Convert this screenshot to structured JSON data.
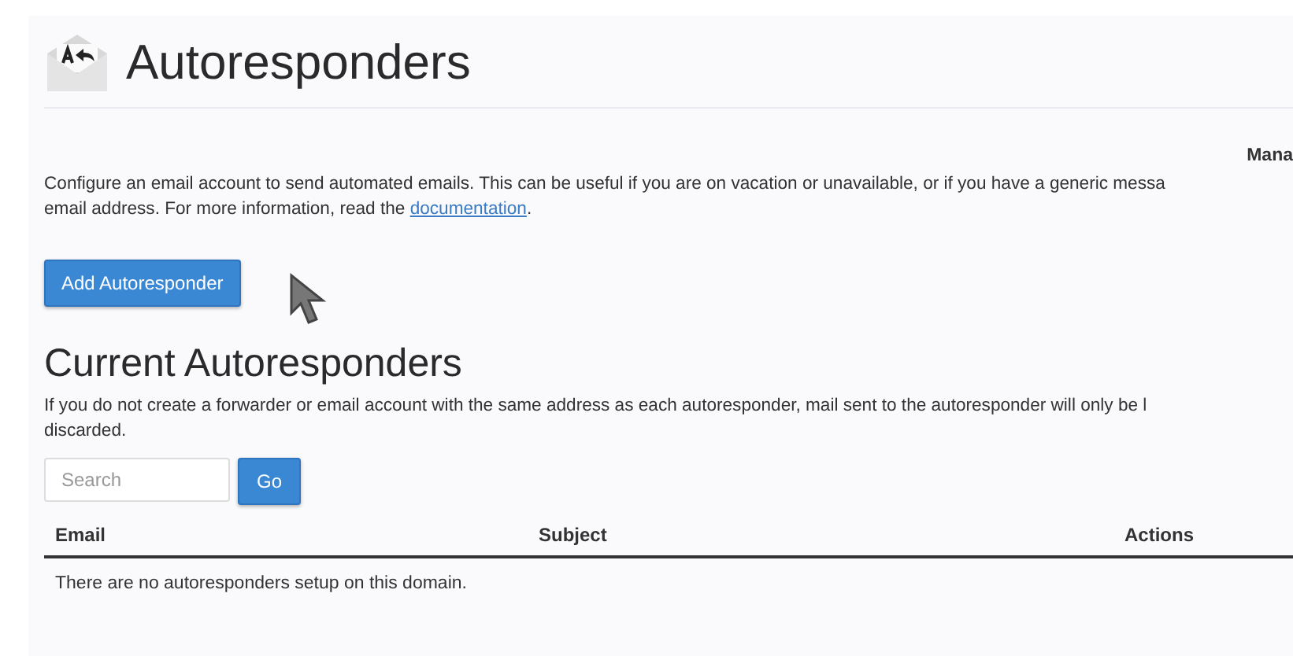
{
  "page_title": "Autoresponders",
  "manage_label": "Mana",
  "intro": {
    "line1": "Configure an email account to send automated emails. This can be useful if you are on vacation or unavailable, or if you have a generic messa",
    "line2": "email address. For more information, read the ",
    "link": "documentation",
    "end": "."
  },
  "add_button": "Add Autoresponder",
  "section_title": "Current Autoresponders",
  "note": {
    "line1": "If you do not create a forwarder or email account with the same address as each autoresponder, mail sent to the autoresponder will only be l",
    "line2": "discarded."
  },
  "search": {
    "placeholder": "Search",
    "button": "Go"
  },
  "table": {
    "columns": [
      "Email",
      "Subject",
      "Actions"
    ],
    "empty_message": "There are no autoresponders setup on this domain."
  }
}
